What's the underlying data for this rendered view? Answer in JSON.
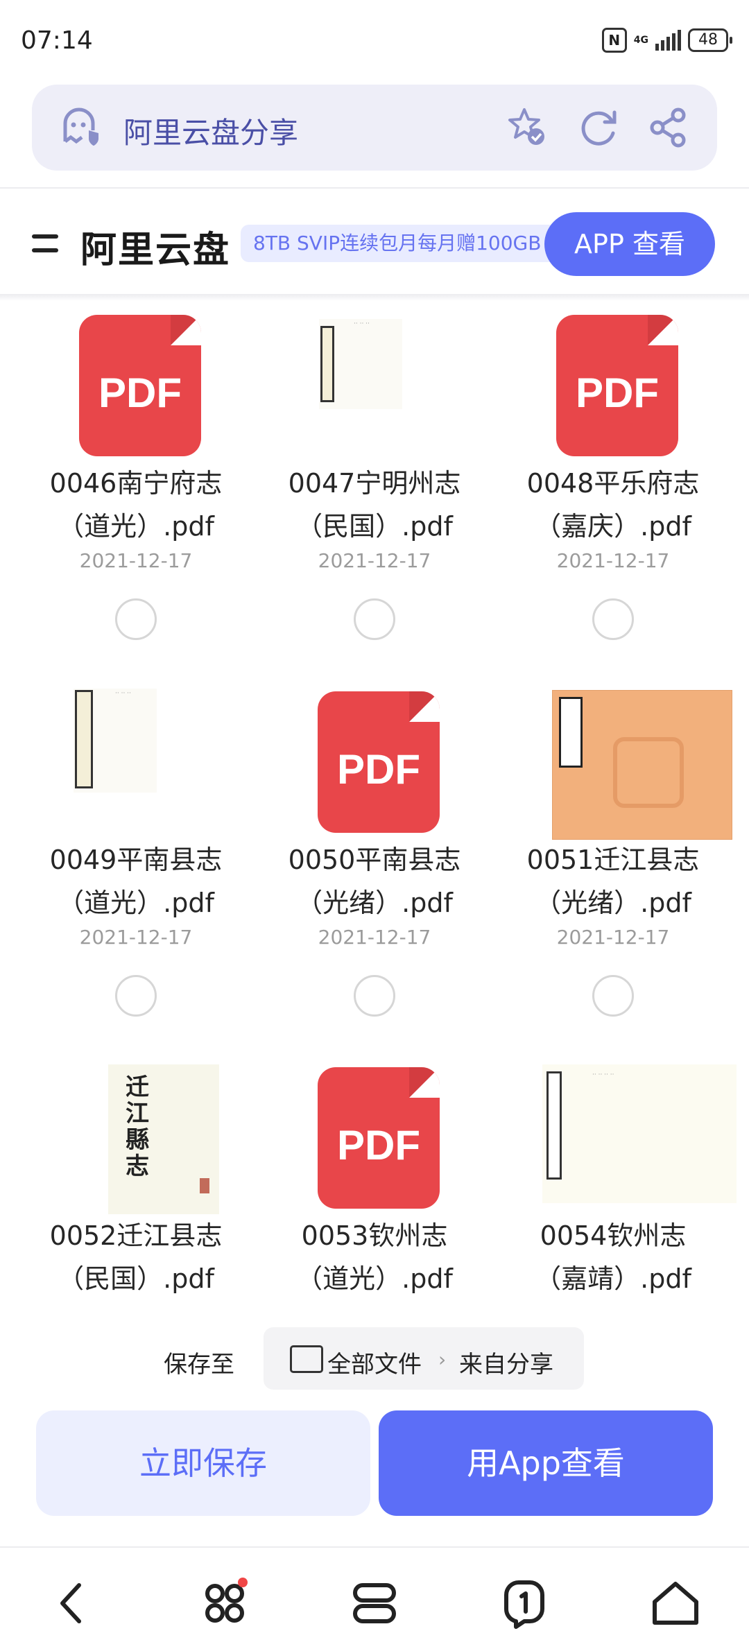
{
  "status_bar": {
    "time": "07:14",
    "network": "4G",
    "battery": "48"
  },
  "browser": {
    "title": "阿里云盘分享",
    "icons": [
      "ghost-shield-icon",
      "star-check-icon",
      "refresh-icon",
      "share-icon"
    ]
  },
  "header": {
    "site_title": "阿里云盘",
    "promo": "8TB SVIP连续包月每月赠100GB",
    "app_button": "APP 查看"
  },
  "files": [
    {
      "name_line1": "0046南宁府志",
      "name_line2": "（道光）.pdf",
      "date": "2021-12-17",
      "thumb": "pdf"
    },
    {
      "name_line1": "0047宁明州志",
      "name_line2": "（民国）.pdf",
      "date": "2021-12-17",
      "thumb": "scan"
    },
    {
      "name_line1": "0048平乐府志",
      "name_line2": "（嘉庆）.pdf",
      "date": "2021-12-17",
      "thumb": "pdf"
    },
    {
      "name_line1": "0049平南县志",
      "name_line2": "（道光）.pdf",
      "date": "2021-12-17",
      "thumb": "scan"
    },
    {
      "name_line1": "0050平南县志",
      "name_line2": "（光绪）.pdf",
      "date": "2021-12-17",
      "thumb": "pdf"
    },
    {
      "name_line1": "0051迁江县志",
      "name_line2": "（光绪）.pdf",
      "date": "2021-12-17",
      "thumb": "cover"
    },
    {
      "name_line1": "0052迁江县志",
      "name_line2": "（民国）.pdf",
      "thumb": "scan"
    },
    {
      "name_line1": "0053钦州志",
      "name_line2": "（道光）.pdf",
      "thumb": "pdf"
    },
    {
      "name_line1": "0054钦州志",
      "name_line2": "（嘉靖）.pdf",
      "thumb": "scan"
    }
  ],
  "pdf_label": "PDF",
  "save_bar": {
    "label": "保存至",
    "path_root": "全部文件",
    "path_child": "来自分享"
  },
  "actions": {
    "save_now": "立即保存",
    "open_app": "用App查看"
  },
  "nav": [
    "back-icon",
    "apps-icon",
    "tabs-icon",
    "notification-icon",
    "home-icon"
  ],
  "colors": {
    "accent": "#5c6ef7",
    "pdf_red": "#e8464a",
    "promo_bg": "#e9ecff"
  }
}
